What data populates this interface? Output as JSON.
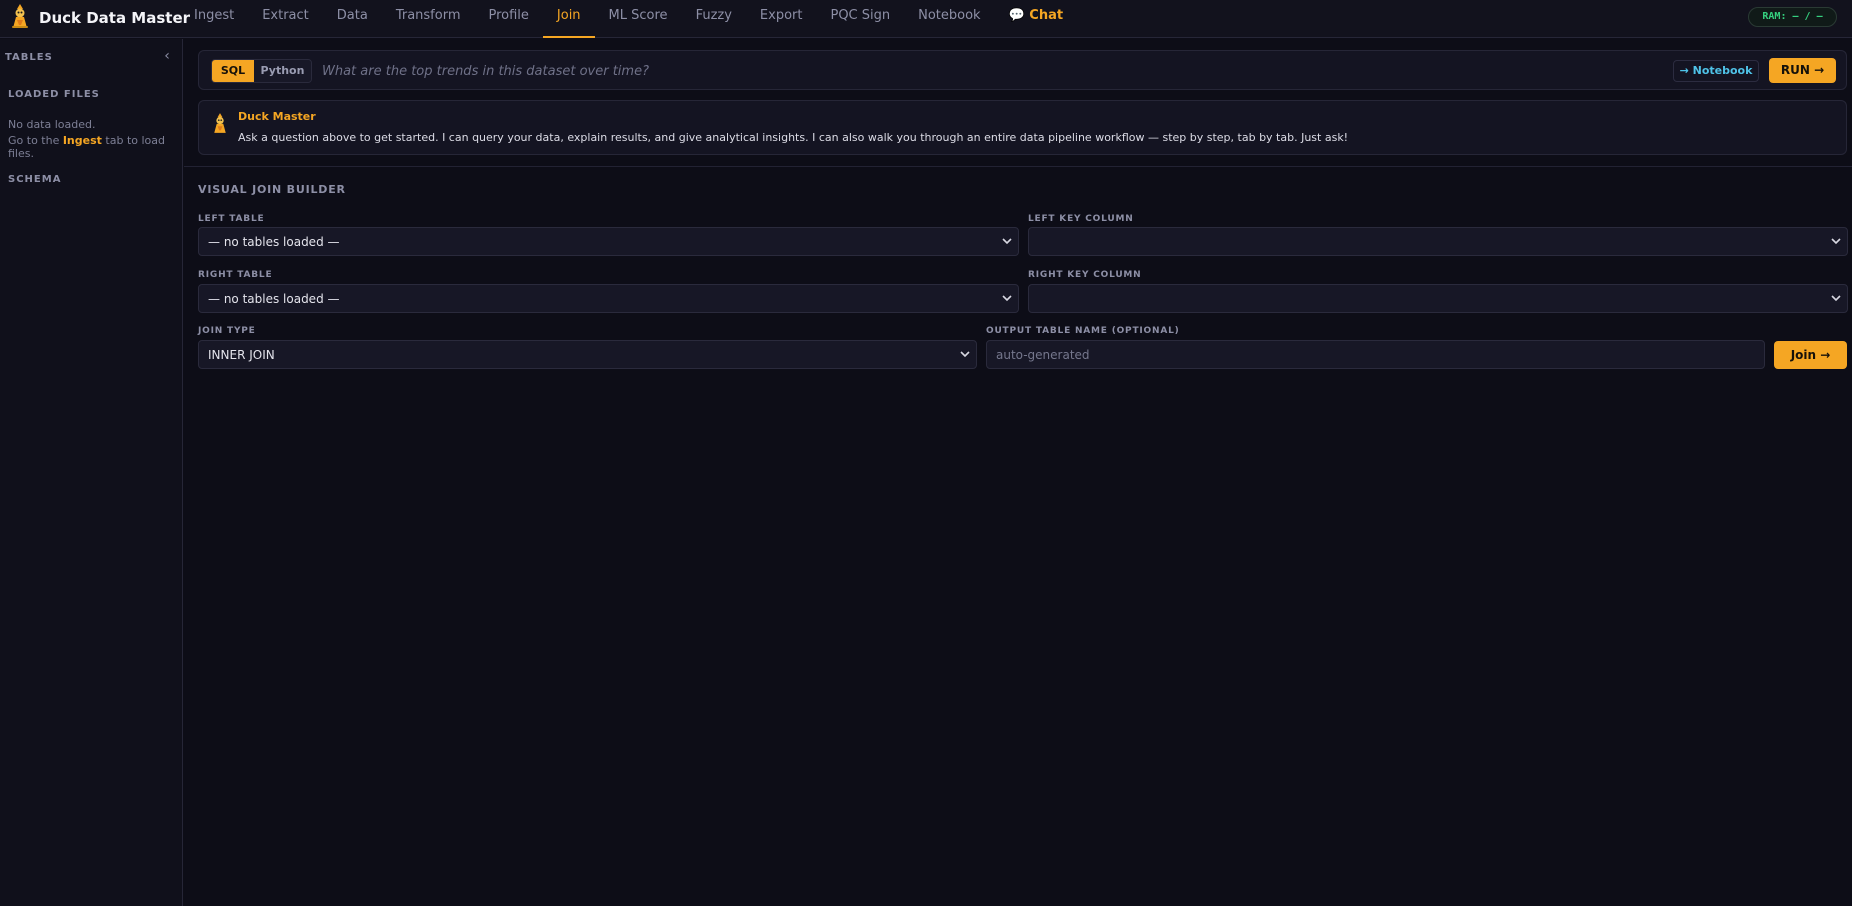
{
  "app": {
    "title": "Duck Data Master",
    "ram": "RAM: — / —"
  },
  "nav": {
    "tabs": [
      "Ingest",
      "Extract",
      "Data",
      "Transform",
      "Profile",
      "Join",
      "ML Score",
      "Fuzzy",
      "Export",
      "PQC Sign",
      "Notebook",
      "💬 Chat"
    ],
    "active": "Join"
  },
  "sidebar": {
    "tables_heading": "TABLES",
    "collapse_icon": "‹",
    "loaded_files_heading": "LOADED FILES",
    "no_data": "No data loaded.",
    "hint_prefix": "Go to the ",
    "hint_link": "Ingest",
    "hint_suffix": " tab to load files.",
    "schema_heading": "SCHEMA"
  },
  "query": {
    "sql_label": "SQL",
    "python_label": "Python",
    "active_lang": "SQL",
    "placeholder": "What are the top trends in this dataset over time?",
    "value": "",
    "notebook_label": "→ Notebook",
    "run_label": "RUN →"
  },
  "assistant": {
    "name": "Duck Master",
    "message": "Ask a question above to get started. I can query your data, explain results, and give analytical insights. I can also walk you through an entire data pipeline workflow — step by step, tab by tab. Just ask!"
  },
  "join_builder": {
    "title": "VISUAL JOIN BUILDER",
    "left_table_label": "LEFT TABLE",
    "left_table_value": "— no tables loaded —",
    "left_key_label": "LEFT KEY COLUMN",
    "left_key_value": "",
    "right_table_label": "RIGHT TABLE",
    "right_table_value": "— no tables loaded —",
    "right_key_label": "RIGHT KEY COLUMN",
    "right_key_value": "",
    "join_type_label": "JOIN TYPE",
    "join_type_value": "INNER JOIN",
    "output_label": "OUTPUT TABLE NAME (OPTIONAL)",
    "output_placeholder": "auto-generated",
    "output_value": "",
    "join_button": "Join →"
  },
  "colors": {
    "accent": "#f5a623",
    "background": "#0d0d17",
    "panel": "#141422",
    "ram_green": "#35d07f",
    "link_cyan": "#4fc3e8"
  },
  "icons": {
    "logo": "duck-master-logo-icon",
    "assistant": "duck-master-avatar-icon",
    "select_arrow": "chevron-down-icon",
    "collapse": "chevron-left-icon"
  }
}
